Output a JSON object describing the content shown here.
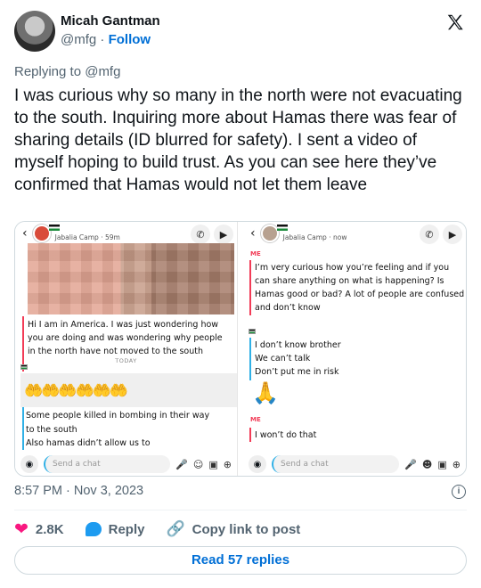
{
  "author": {
    "name": "Micah Gantman",
    "handle": "@mfg",
    "separator": "·",
    "follow_label": "Follow"
  },
  "reply_to": "Replying to @mfg",
  "tweet_text": "I was curious why so many in the north were not evacuating to the south. Inquiring more about Hamas there was fear of sharing details (ID blurred for safety). I sent a video of myself hoping to build trust. As you can see here they’ve confirmed that Hamas would not let them leave",
  "media": {
    "left": {
      "contact": "Jabalia Camp · 59m",
      "message_me": "Hi I am in America. I was just wondering how you are doing and was wondering why people in the north have not moved to the south",
      "day_label": "TODAY",
      "emoji": "🤲🤲🤲🤲🤲🤲",
      "reply_lines": [
        "Some people killed in bombing in their way",
        "to the south",
        "Also hamas didn’t allow us to"
      ],
      "chat_placeholder": "Send a chat"
    },
    "right": {
      "contact": "Jabalia Camp · now",
      "me_label": "ME",
      "message_me": "I’m very curious how you’re feeling and if you can share anything on what is happening? Is Hamas good or bad? A lot of people are confused and don’t know",
      "reply_lines": [
        "I don’t know brother",
        "We can’t talk",
        "Don’t put me in risk"
      ],
      "emoji": "🙏",
      "me_label2": "ME",
      "message_me2": "I won’t do that",
      "chat_placeholder": "Send a chat"
    }
  },
  "timestamp": "8:57 PM · Nov 3, 2023",
  "actions": {
    "likes": "2.8K",
    "reply_label": "Reply",
    "copy_label": "Copy link to post"
  },
  "read_replies": "Read 57 replies",
  "colors": {
    "follow": "#006fd6",
    "heart": "#f91880",
    "muted": "#536471"
  }
}
